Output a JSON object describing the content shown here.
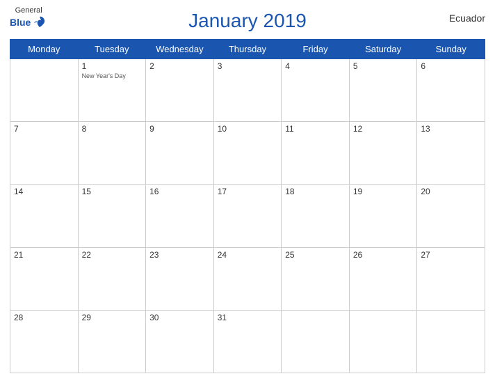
{
  "header": {
    "logo_general": "General",
    "logo_blue": "Blue",
    "title": "January 2019",
    "country": "Ecuador"
  },
  "weekdays": [
    "Monday",
    "Tuesday",
    "Wednesday",
    "Thursday",
    "Friday",
    "Saturday",
    "Sunday"
  ],
  "weeks": [
    [
      {
        "day": "",
        "empty": true
      },
      {
        "day": "1",
        "holiday": "New Year's Day"
      },
      {
        "day": "2",
        "holiday": ""
      },
      {
        "day": "3",
        "holiday": ""
      },
      {
        "day": "4",
        "holiday": ""
      },
      {
        "day": "5",
        "holiday": ""
      },
      {
        "day": "6",
        "holiday": ""
      }
    ],
    [
      {
        "day": "7",
        "holiday": ""
      },
      {
        "day": "8",
        "holiday": ""
      },
      {
        "day": "9",
        "holiday": ""
      },
      {
        "day": "10",
        "holiday": ""
      },
      {
        "day": "11",
        "holiday": ""
      },
      {
        "day": "12",
        "holiday": ""
      },
      {
        "day": "13",
        "holiday": ""
      }
    ],
    [
      {
        "day": "14",
        "holiday": ""
      },
      {
        "day": "15",
        "holiday": ""
      },
      {
        "day": "16",
        "holiday": ""
      },
      {
        "day": "17",
        "holiday": ""
      },
      {
        "day": "18",
        "holiday": ""
      },
      {
        "day": "19",
        "holiday": ""
      },
      {
        "day": "20",
        "holiday": ""
      }
    ],
    [
      {
        "day": "21",
        "holiday": ""
      },
      {
        "day": "22",
        "holiday": ""
      },
      {
        "day": "23",
        "holiday": ""
      },
      {
        "day": "24",
        "holiday": ""
      },
      {
        "day": "25",
        "holiday": ""
      },
      {
        "day": "26",
        "holiday": ""
      },
      {
        "day": "27",
        "holiday": ""
      }
    ],
    [
      {
        "day": "28",
        "holiday": ""
      },
      {
        "day": "29",
        "holiday": ""
      },
      {
        "day": "30",
        "holiday": ""
      },
      {
        "day": "31",
        "holiday": ""
      },
      {
        "day": "",
        "empty": true
      },
      {
        "day": "",
        "empty": true
      },
      {
        "day": "",
        "empty": true
      }
    ]
  ]
}
